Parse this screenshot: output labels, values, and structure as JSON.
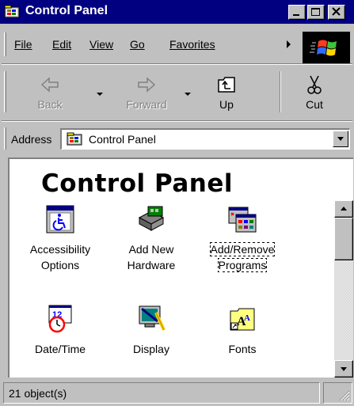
{
  "window": {
    "title": "Control Panel",
    "title_icon": "control-panel-icon"
  },
  "colors": {
    "titlebar": "#000080",
    "chrome": "#c0c0c0",
    "content": "#ffffff"
  },
  "menu": {
    "items": [
      {
        "label": "File"
      },
      {
        "label": "Edit"
      },
      {
        "label": "View"
      },
      {
        "label": "Go"
      },
      {
        "label": "Favorites"
      }
    ],
    "more_icon": "chevron-right-icon"
  },
  "toolbar": {
    "back": {
      "label": "Back",
      "icon": "back-arrow-icon"
    },
    "forward": {
      "label": "Forward",
      "icon": "forward-arrow-icon"
    },
    "up": {
      "label": "Up",
      "icon": "up-folder-icon"
    },
    "cut": {
      "label": "Cut",
      "icon": "scissors-icon"
    }
  },
  "address": {
    "label": "Address",
    "value": "Control Panel",
    "icon": "control-panel-icon"
  },
  "content": {
    "title": "Control Panel",
    "items": [
      {
        "label": "Accessibility Options",
        "icon": "accessibility-icon"
      },
      {
        "label": "Add New Hardware",
        "icon": "hardware-icon"
      },
      {
        "label": "Add/Remove Programs",
        "icon": "programs-icon",
        "focused": true
      },
      {
        "label": "Date/Time",
        "icon": "clock-icon"
      },
      {
        "label": "Display",
        "icon": "monitor-icon"
      },
      {
        "label": "Fonts",
        "icon": "fonts-folder-icon"
      }
    ]
  },
  "status": {
    "text": "21 object(s)"
  }
}
